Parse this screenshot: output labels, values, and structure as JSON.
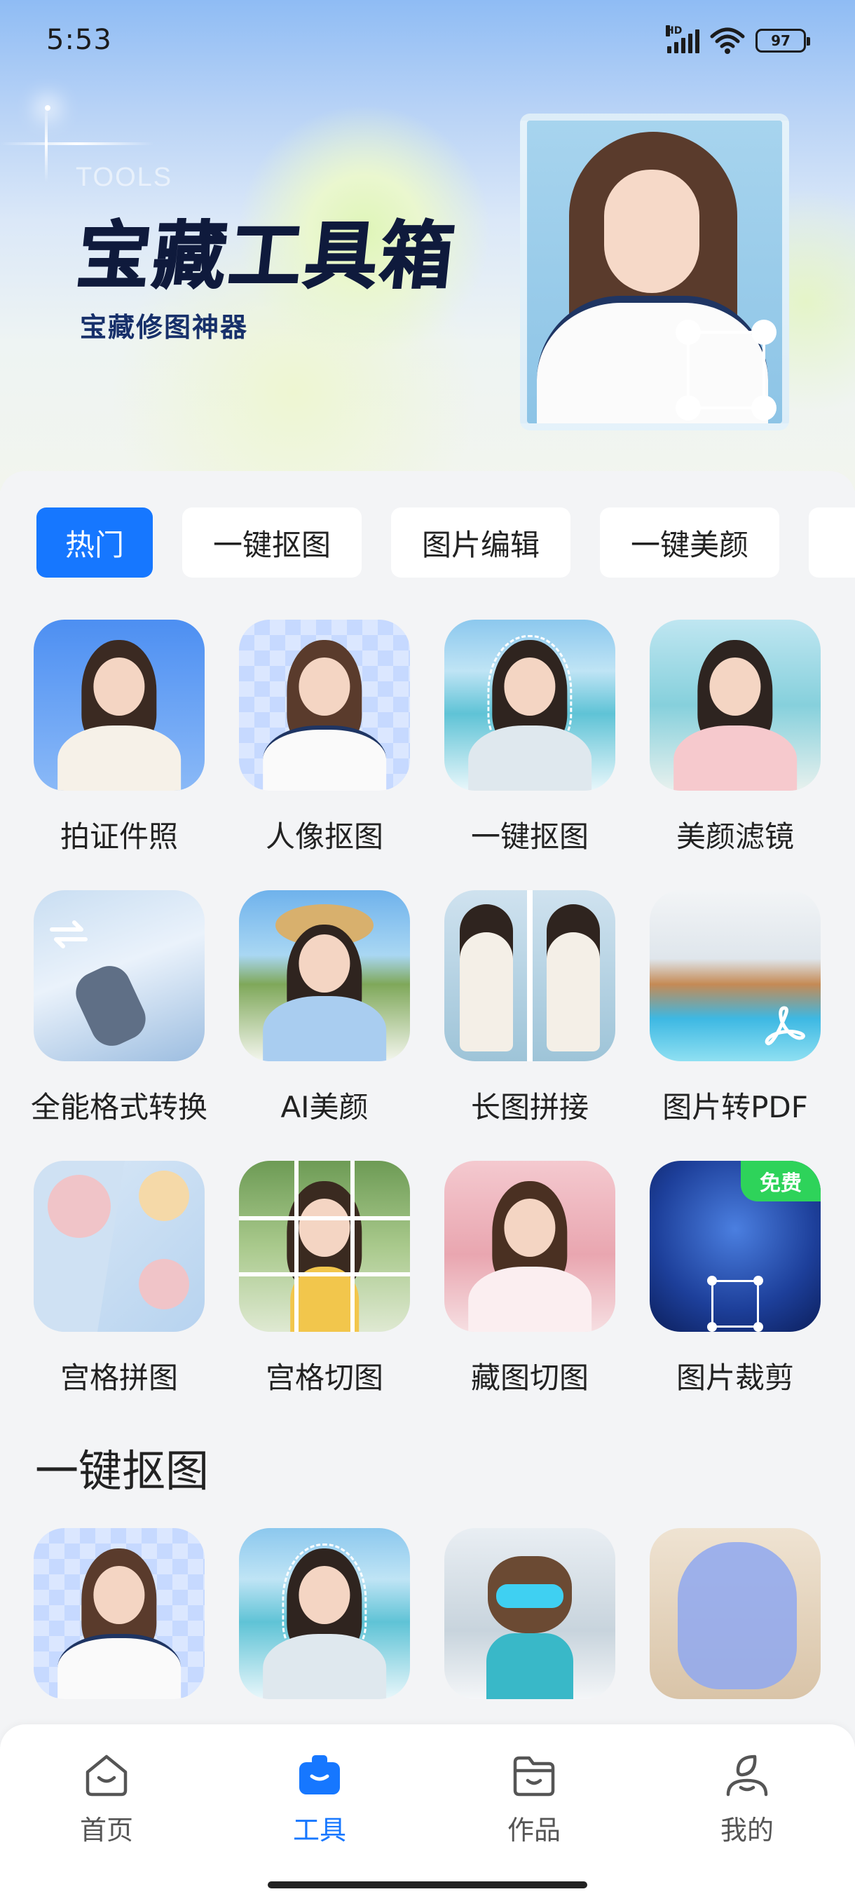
{
  "status_bar": {
    "time": "5:53",
    "network": "HD",
    "battery": "97"
  },
  "hero": {
    "watermark": "TOOLS",
    "title": "宝藏工具箱",
    "subtitle": "宝藏修图神器"
  },
  "category_tabs": [
    {
      "label": "热门",
      "active": true
    },
    {
      "label": "一键抠图",
      "active": false
    },
    {
      "label": "图片编辑",
      "active": false
    },
    {
      "label": "一键美颜",
      "active": false
    }
  ],
  "tools": [
    {
      "label": "拍证件照"
    },
    {
      "label": "人像抠图"
    },
    {
      "label": "一键抠图"
    },
    {
      "label": "美颜滤镜"
    },
    {
      "label": "全能格式转换"
    },
    {
      "label": "AI美颜"
    },
    {
      "label": "长图拼接"
    },
    {
      "label": "图片转PDF"
    },
    {
      "label": "宫格拼图"
    },
    {
      "label": "宫格切图"
    },
    {
      "label": "藏图切图"
    },
    {
      "label": "图片裁剪",
      "badge": "免费"
    }
  ],
  "section": {
    "title": "一键抠图"
  },
  "bottom_nav": [
    {
      "label": "首页",
      "icon": "home-icon",
      "active": false
    },
    {
      "label": "工具",
      "icon": "toolbox-icon",
      "active": true
    },
    {
      "label": "作品",
      "icon": "folder-icon",
      "active": false
    },
    {
      "label": "我的",
      "icon": "profile-icon",
      "active": false
    }
  ],
  "colors": {
    "accent": "#1677ff",
    "free_badge": "#2ed35a"
  }
}
